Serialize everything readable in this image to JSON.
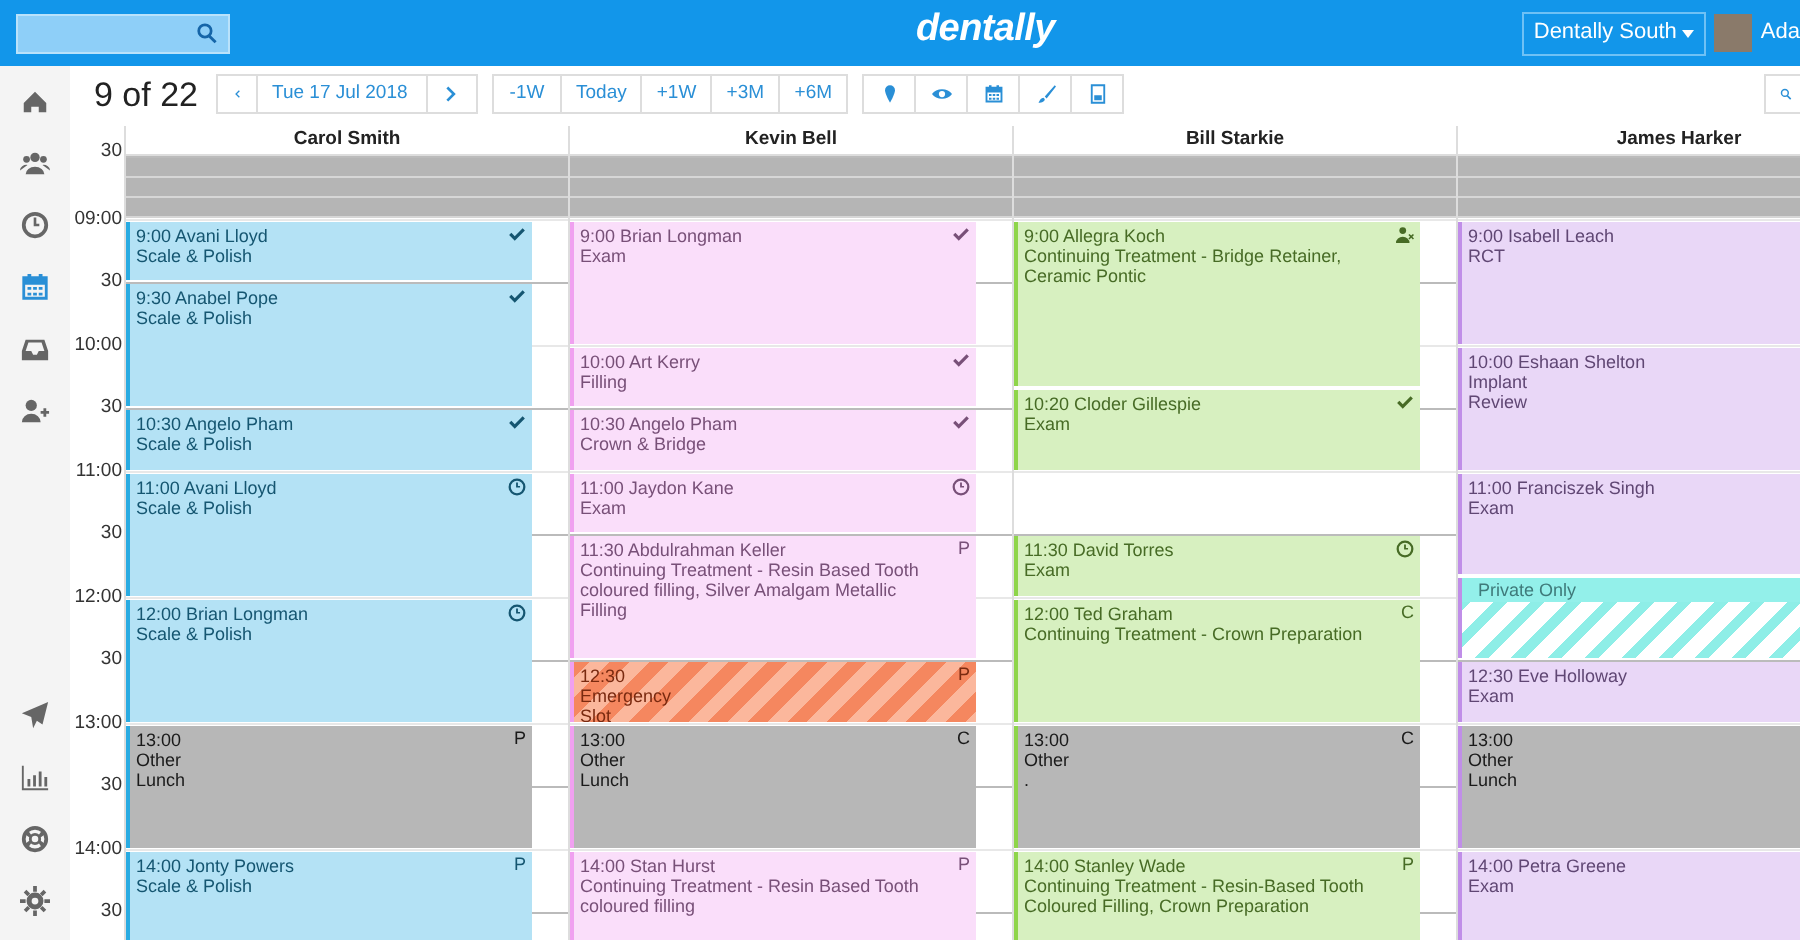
{
  "navbar": {
    "logo": "dentally",
    "practice": "Dentally South",
    "user": "Ada"
  },
  "sidebar": {
    "items": [
      {
        "selected": false
      },
      {
        "selected": false
      },
      {
        "selected": false
      },
      {
        "selected": true
      },
      {
        "selected": false
      },
      {
        "selected": false
      }
    ]
  },
  "toolbar": {
    "page": "9 of 22",
    "date": "Tue 17 Jul 2018",
    "jumps": [
      "-1W",
      "Today",
      "+1W",
      "+3M",
      "+6M"
    ]
  },
  "time_labels": [
    "30",
    "09:00",
    "30",
    "10:00",
    "30",
    "11:00",
    "30",
    "12:00",
    "30",
    "13:00",
    "30",
    "14:00",
    "30"
  ],
  "columns": [
    {
      "name": "Carol Smith",
      "color": "#29abe2",
      "slots": [
        {
          "kind": "closed"
        },
        {
          "kind": "continued"
        },
        {
          "kind": "continued"
        },
        {
          "kind": "appointment",
          "lines": [
            "9:00 Avani Lloyd",
            "Scale & Polish"
          ],
          "arrived": true
        },
        {
          "kind": "continued"
        },
        {
          "kind": "continued"
        },
        {
          "kind": "appointment",
          "lines": [
            "9:30 Anabel Pope",
            "Scale & Polish"
          ],
          "arrived": true
        },
        {
          "kind": "continued"
        },
        {
          "kind": "continued"
        },
        {
          "kind": "continued"
        },
        {
          "kind": "continued"
        },
        {
          "kind": "continued"
        },
        {
          "kind": "appointment",
          "lines": [
            "10:30 Angelo Pham",
            "Scale & Polish"
          ],
          "arrived": true
        },
        {
          "kind": "continued"
        },
        {
          "kind": "continued"
        },
        {
          "kind": "appointment",
          "lines": [
            "11:00 Avani Lloyd",
            "Scale & Polish"
          ],
          "waiting": true
        },
        {
          "kind": "continued"
        },
        {
          "kind": "continued"
        },
        {
          "kind": "continued"
        },
        {
          "kind": "continued"
        },
        {
          "kind": "continued"
        },
        {
          "kind": "appointment",
          "lines": [
            "12:00 Brian Longman",
            "Scale & Polish"
          ],
          "waiting": true
        },
        {
          "kind": "continued"
        },
        {
          "kind": "continued"
        },
        {
          "kind": "continued"
        },
        {
          "kind": "continued"
        },
        {
          "kind": "continued"
        },
        {
          "kind": "other",
          "lines": [
            "13:00",
            "Other",
            "Lunch"
          ],
          "flag": "P"
        },
        {
          "kind": "continued"
        },
        {
          "kind": "continued"
        },
        {
          "kind": "continued"
        },
        {
          "kind": "continued"
        },
        {
          "kind": "continued"
        },
        {
          "kind": "appointment",
          "lines": [
            "14:00 Jonty Powers",
            "Scale & Polish"
          ],
          "flag": "P"
        },
        {
          "kind": "continued"
        },
        {
          "kind": "continued"
        },
        {
          "kind": "continued"
        },
        {
          "kind": "continued"
        },
        {
          "kind": "continued"
        }
      ]
    },
    {
      "name": "Kevin Bell",
      "color": "#f0a0f0",
      "slots": [
        {
          "kind": "closed"
        },
        {
          "kind": "continued"
        },
        {
          "kind": "continued"
        },
        {
          "kind": "appointment",
          "lines": [
            "9:00 Brian Longman",
            "Exam"
          ],
          "arrived": true
        },
        {
          "kind": "continued"
        },
        {
          "kind": "continued"
        },
        {
          "kind": "continued"
        },
        {
          "kind": "continued"
        },
        {
          "kind": "continued"
        },
        {
          "kind": "appointment",
          "lines": [
            "10:00 Art Kerry",
            "Filling"
          ],
          "arrived": true
        },
        {
          "kind": "continued"
        },
        {
          "kind": "continued"
        },
        {
          "kind": "appointment",
          "lines": [
            "10:30 Angelo Pham",
            "Crown & Bridge"
          ],
          "arrived": true
        },
        {
          "kind": "continued"
        },
        {
          "kind": "continued"
        },
        {
          "kind": "appointment",
          "lines": [
            "11:00 Jaydon Kane",
            "Exam"
          ],
          "waiting": true
        },
        {
          "kind": "continued"
        },
        {
          "kind": "continued"
        },
        {
          "kind": "appointment",
          "lines": [
            "11:30 Abdulrahman Keller",
            "Continuing Treatment - Resin Based Tooth coloured filling, Silver Amalgam Metallic Filling"
          ],
          "flag": "P"
        },
        {
          "kind": "continued"
        },
        {
          "kind": "continued"
        },
        {
          "kind": "continued"
        },
        {
          "kind": "continued"
        },
        {
          "kind": "continued"
        },
        {
          "kind": "emergency",
          "lines": [
            "12:30",
            "Emergency",
            "Slot"
          ],
          "flag": "P"
        },
        {
          "kind": "continued"
        },
        {
          "kind": "continued"
        },
        {
          "kind": "other",
          "lines": [
            "13:00",
            "Other",
            "Lunch"
          ],
          "flag": "C"
        },
        {
          "kind": "continued"
        },
        {
          "kind": "continued"
        },
        {
          "kind": "continued"
        },
        {
          "kind": "continued"
        },
        {
          "kind": "continued"
        },
        {
          "kind": "appointment",
          "lines": [
            "14:00 Stan Hurst",
            "Continuing Treatment - Resin Based Tooth coloured filling"
          ],
          "flag": "P"
        },
        {
          "kind": "continued"
        },
        {
          "kind": "continued"
        },
        {
          "kind": "continued"
        },
        {
          "kind": "continued"
        },
        {
          "kind": "continued"
        }
      ]
    },
    {
      "name": "Bill Starkie",
      "color": "#8ed54a",
      "slots": [
        {
          "kind": "closed"
        },
        {
          "kind": "continued"
        },
        {
          "kind": "continued"
        },
        {
          "kind": "appointment",
          "lines": [
            "9:00 Allegra Koch",
            "Continuing Treatment - Bridge Retainer, Ceramic Pontic"
          ],
          "in_treatment": true
        },
        {
          "kind": "continued"
        },
        {
          "kind": "continued"
        },
        {
          "kind": "continued"
        },
        {
          "kind": "continued"
        },
        {
          "kind": "continued"
        },
        {
          "kind": "continued"
        },
        {
          "kind": "continued"
        },
        {
          "kind": "appointment",
          "lines": [
            "10:20 Cloder Gillespie",
            "Exam"
          ],
          "arrived": true
        },
        {
          "kind": "continued"
        },
        {
          "kind": "continued"
        },
        {
          "kind": "continued"
        },
        {
          "kind": "free"
        },
        {
          "kind": "free"
        },
        {
          "kind": "free"
        },
        {
          "kind": "appointment",
          "lines": [
            "11:30 David Torres",
            "Exam"
          ],
          "waiting": true
        },
        {
          "kind": "continued"
        },
        {
          "kind": "continued"
        },
        {
          "kind": "appointment",
          "lines": [
            "12:00 Ted Graham",
            "Continuing Treatment - Crown Preparation"
          ],
          "flag": "C"
        },
        {
          "kind": "continued"
        },
        {
          "kind": "continued"
        },
        {
          "kind": "continued"
        },
        {
          "kind": "continued"
        },
        {
          "kind": "continued"
        },
        {
          "kind": "other",
          "lines": [
            "13:00",
            "Other",
            "."
          ],
          "flag": "C"
        },
        {
          "kind": "continued"
        },
        {
          "kind": "continued"
        },
        {
          "kind": "continued"
        },
        {
          "kind": "continued"
        },
        {
          "kind": "continued"
        },
        {
          "kind": "appointment",
          "lines": [
            "14:00 Stanley Wade",
            "Continuing Treatment - Resin-Based Tooth Coloured Filling, Crown Preparation"
          ],
          "flag": "P"
        },
        {
          "kind": "continued"
        },
        {
          "kind": "continued"
        },
        {
          "kind": "continued"
        },
        {
          "kind": "continued"
        },
        {
          "kind": "continued"
        }
      ]
    },
    {
      "name": "James Harker",
      "color": "#c08ee8",
      "slots": [
        {
          "kind": "closed"
        },
        {
          "kind": "continued"
        },
        {
          "kind": "continued"
        },
        {
          "kind": "appointment",
          "lines": [
            "9:00 Isabell Leach",
            "RCT"
          ]
        },
        {
          "kind": "continued"
        },
        {
          "kind": "continued"
        },
        {
          "kind": "continued"
        },
        {
          "kind": "continued"
        },
        {
          "kind": "continued"
        },
        {
          "kind": "appointment",
          "lines": [
            "10:00 Eshaan Shelton",
            "Implant",
            "Review"
          ]
        },
        {
          "kind": "continued"
        },
        {
          "kind": "continued"
        },
        {
          "kind": "continued"
        },
        {
          "kind": "continued"
        },
        {
          "kind": "continued"
        },
        {
          "kind": "appointment",
          "lines": [
            "11:00 Franciszek Singh",
            "Exam"
          ]
        },
        {
          "kind": "continued"
        },
        {
          "kind": "continued"
        },
        {
          "kind": "continued"
        },
        {
          "kind": "continued"
        },
        {
          "kind": "private",
          "lines": [
            "Private Only"
          ]
        },
        {
          "kind": "continued"
        },
        {
          "kind": "continued"
        },
        {
          "kind": "continued"
        },
        {
          "kind": "appointment",
          "lines": [
            "12:30 Eve Holloway",
            "Exam"
          ]
        },
        {
          "kind": "continued"
        },
        {
          "kind": "continued"
        },
        {
          "kind": "other",
          "lines": [
            "13:00",
            "Other",
            "Lunch"
          ]
        },
        {
          "kind": "continued"
        },
        {
          "kind": "continued"
        },
        {
          "kind": "continued"
        },
        {
          "kind": "continued"
        },
        {
          "kind": "continued"
        },
        {
          "kind": "appointment",
          "lines": [
            "14:00 Petra Greene",
            "Exam"
          ]
        },
        {
          "kind": "continued"
        },
        {
          "kind": "continued"
        },
        {
          "kind": "continued"
        },
        {
          "kind": "continued"
        },
        {
          "kind": "continued"
        }
      ]
    }
  ]
}
